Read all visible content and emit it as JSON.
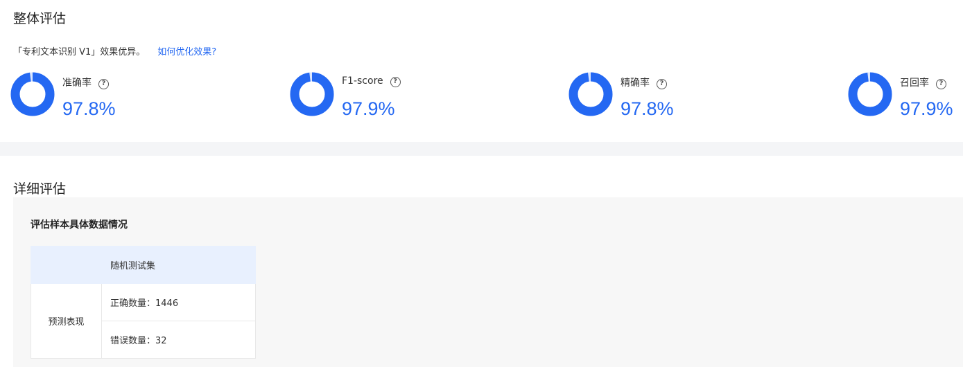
{
  "overall": {
    "title": "整体评估",
    "summary_text": "「专利文本识别 V1」效果优异。",
    "optimize_link": "如何优化效果?",
    "metrics": [
      {
        "label": "准确率",
        "value_text": "97.8%",
        "value": 0.978
      },
      {
        "label": "F1-score",
        "value_text": "97.9%",
        "value": 0.979
      },
      {
        "label": "精确率",
        "value_text": "97.8%",
        "value": 0.978
      },
      {
        "label": "召回率",
        "value_text": "97.9%",
        "value": 0.979
      }
    ],
    "help_glyph": "?"
  },
  "detail": {
    "title": "详细评估",
    "box_title": "评估样本具体数据情况",
    "table": {
      "column_header": "随机测试集",
      "row_header": "预测表现",
      "correct": "正确数量：1446",
      "wrong": "错误数量：32"
    }
  },
  "colors": {
    "accent": "#2468f2",
    "donut_track": "#dbe6fd"
  },
  "icons": {
    "help": "question-circle-icon"
  }
}
